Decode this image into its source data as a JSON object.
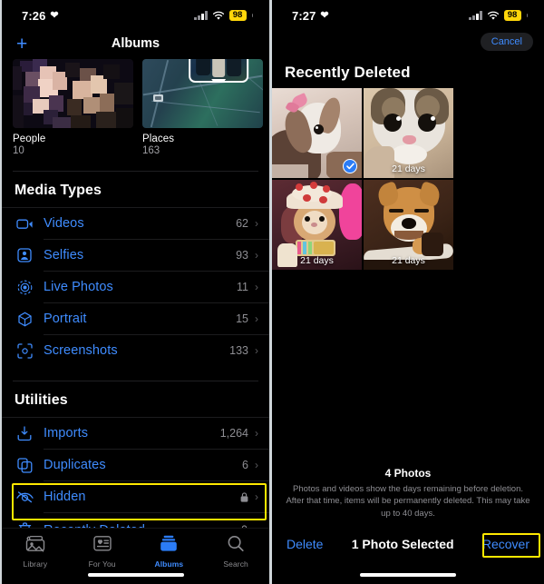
{
  "left_screen": {
    "status_bar": {
      "time": "7:26",
      "heart_icon": "heart-icon",
      "battery": "98",
      "signal_icon": "cellular-bars-icon",
      "wifi_icon": "wifi-icon"
    },
    "nav": {
      "add_icon": "plus-icon",
      "title": "Albums"
    },
    "top_albums": [
      {
        "name": "People",
        "count": "10"
      },
      {
        "name": "Places",
        "count": "163"
      }
    ],
    "sections": [
      {
        "title": "Media Types",
        "rows": [
          {
            "icon": "video-camera-icon",
            "label": "Videos",
            "count": "62",
            "locked": false
          },
          {
            "icon": "selfie-person-icon",
            "label": "Selfies",
            "count": "93",
            "locked": false
          },
          {
            "icon": "live-photo-icon",
            "label": "Live Photos",
            "count": "11",
            "locked": false
          },
          {
            "icon": "portrait-cube-icon",
            "label": "Portrait",
            "count": "15",
            "locked": false
          },
          {
            "icon": "screenshot-icon",
            "label": "Screenshots",
            "count": "133",
            "locked": false
          }
        ]
      },
      {
        "title": "Utilities",
        "rows": [
          {
            "icon": "import-icon",
            "label": "Imports",
            "count": "1,264",
            "locked": false
          },
          {
            "icon": "duplicates-icon",
            "label": "Duplicates",
            "count": "6",
            "locked": false
          },
          {
            "icon": "hidden-eye-icon",
            "label": "Hidden",
            "count": "",
            "locked": true
          },
          {
            "icon": "trash-icon",
            "label": "Recently Deleted",
            "count": "",
            "locked": true
          }
        ]
      }
    ],
    "highlight": {
      "target": "Recently Deleted",
      "color": "#ffe800"
    },
    "tabs": [
      {
        "icon": "library-photos-icon",
        "label": "Library",
        "active": false
      },
      {
        "icon": "for-you-card-icon",
        "label": "For You",
        "active": false
      },
      {
        "icon": "albums-stack-icon",
        "label": "Albums",
        "active": true
      },
      {
        "icon": "search-magnifier-icon",
        "label": "Search",
        "active": false
      }
    ]
  },
  "right_screen": {
    "status_bar": {
      "time": "7:27",
      "heart_icon": "heart-icon",
      "battery": "98",
      "signal_icon": "cellular-bars-icon",
      "wifi_icon": "wifi-icon"
    },
    "nav": {
      "cancel_label": "Cancel",
      "title": "Recently Deleted"
    },
    "photos": [
      {
        "subject": "rabbit",
        "days_label": "",
        "selected": true
      },
      {
        "subject": "cat",
        "days_label": "21 days",
        "selected": false
      },
      {
        "subject": "hamster",
        "days_label": "21 days",
        "selected": false
      },
      {
        "subject": "shiba-dog",
        "days_label": "21 days",
        "selected": false
      }
    ],
    "footer": {
      "count_label": "4 Photos",
      "description": "Photos and videos show the days remaining before deletion. After that time, items will be permanently deleted. This may take up to 40 days."
    },
    "actions": {
      "delete_label": "Delete",
      "selection_label": "1 Photo Selected",
      "recover_label": "Recover"
    },
    "highlight": {
      "target": "Recover",
      "color": "#ffe800"
    }
  }
}
